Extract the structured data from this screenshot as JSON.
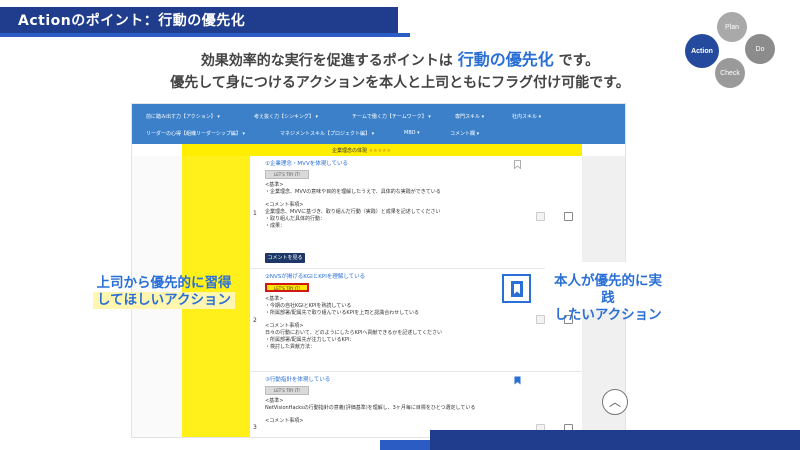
{
  "header": {
    "title": "Actionのポイント：行動の優先化"
  },
  "cycle": {
    "plan": "Plan",
    "action": "Action",
    "do": "Do",
    "check": "Check"
  },
  "headline": {
    "line1_prefix": "効果効率的な実行を促進するポイントは",
    "line1_accent": "行動の優先化",
    "line1_suffix": "です。",
    "line2": "優先して身につけるアクションを本人と上司ともにフラグ付け可能です。"
  },
  "nav": {
    "items": [
      "前に踏み出す力【アクション】",
      "考え抜く力【シンキング】",
      "チームで働く力【チームワーク】",
      "専門スキル",
      "社内スキル",
      "リーダーの心得【組織リーダーシップ編】",
      "マネジメントスキル【プロジェクト編】",
      "MBO",
      "コメント欄"
    ]
  },
  "band": {
    "label": "企業理念の体現",
    "stars": "★★★★★"
  },
  "rows": [
    {
      "num": "1",
      "title": "①企業理念・MVVを体現している",
      "tryit": "LET'S TRY IT!",
      "text": "<基準>\n・企業理念、MVVの意味や目的を理解したうえで、具体的な実践ができている\n\n<コメント事項>\n企業理念、MVVに基づき、取り組んだ行動（実践）と成果を記述してください\n・取り組んだ具体的行動：\n・成果：",
      "button": "コメントを見る"
    },
    {
      "num": "2",
      "title": "②NVSが掲げるKGIとKPIを理解している",
      "tryit": "LET'S TRY IT!",
      "text": "<基準>\n・今期の自社KGIとKPIを熟読している\n・所属部署/配属先で取り組んでいるKPIを上司と認識合わせしている\n\n<コメント事項>\n日々の行動において、どのようにしたらKPIへ貢献できるかを記述してください\n・所属部署/配属先が注力しているKPI：\n・検討した貢献方法："
    },
    {
      "num": "3",
      "title": "③行動指針を体現している",
      "tryit": "LET'S TRY IT!",
      "text": "<基準>\nNetVisionHacksの行動指針の意義(評価基準)を理解し、3ヶ月毎に目標をひとつ選定している\n\n<コメント事項>"
    }
  ],
  "callouts": {
    "left_line1": "上司から優先的に習得",
    "left_line2": "してほしいアクション",
    "right_line1": "本人が優先的に実践",
    "right_line2": "したいアクション"
  },
  "scroll_top": {
    "icon": "chevron-up-icon",
    "glyph": "︿"
  },
  "colors": {
    "accent": "#2a6fd6",
    "navy": "#1f3d8c",
    "yellow": "#ffee00"
  }
}
